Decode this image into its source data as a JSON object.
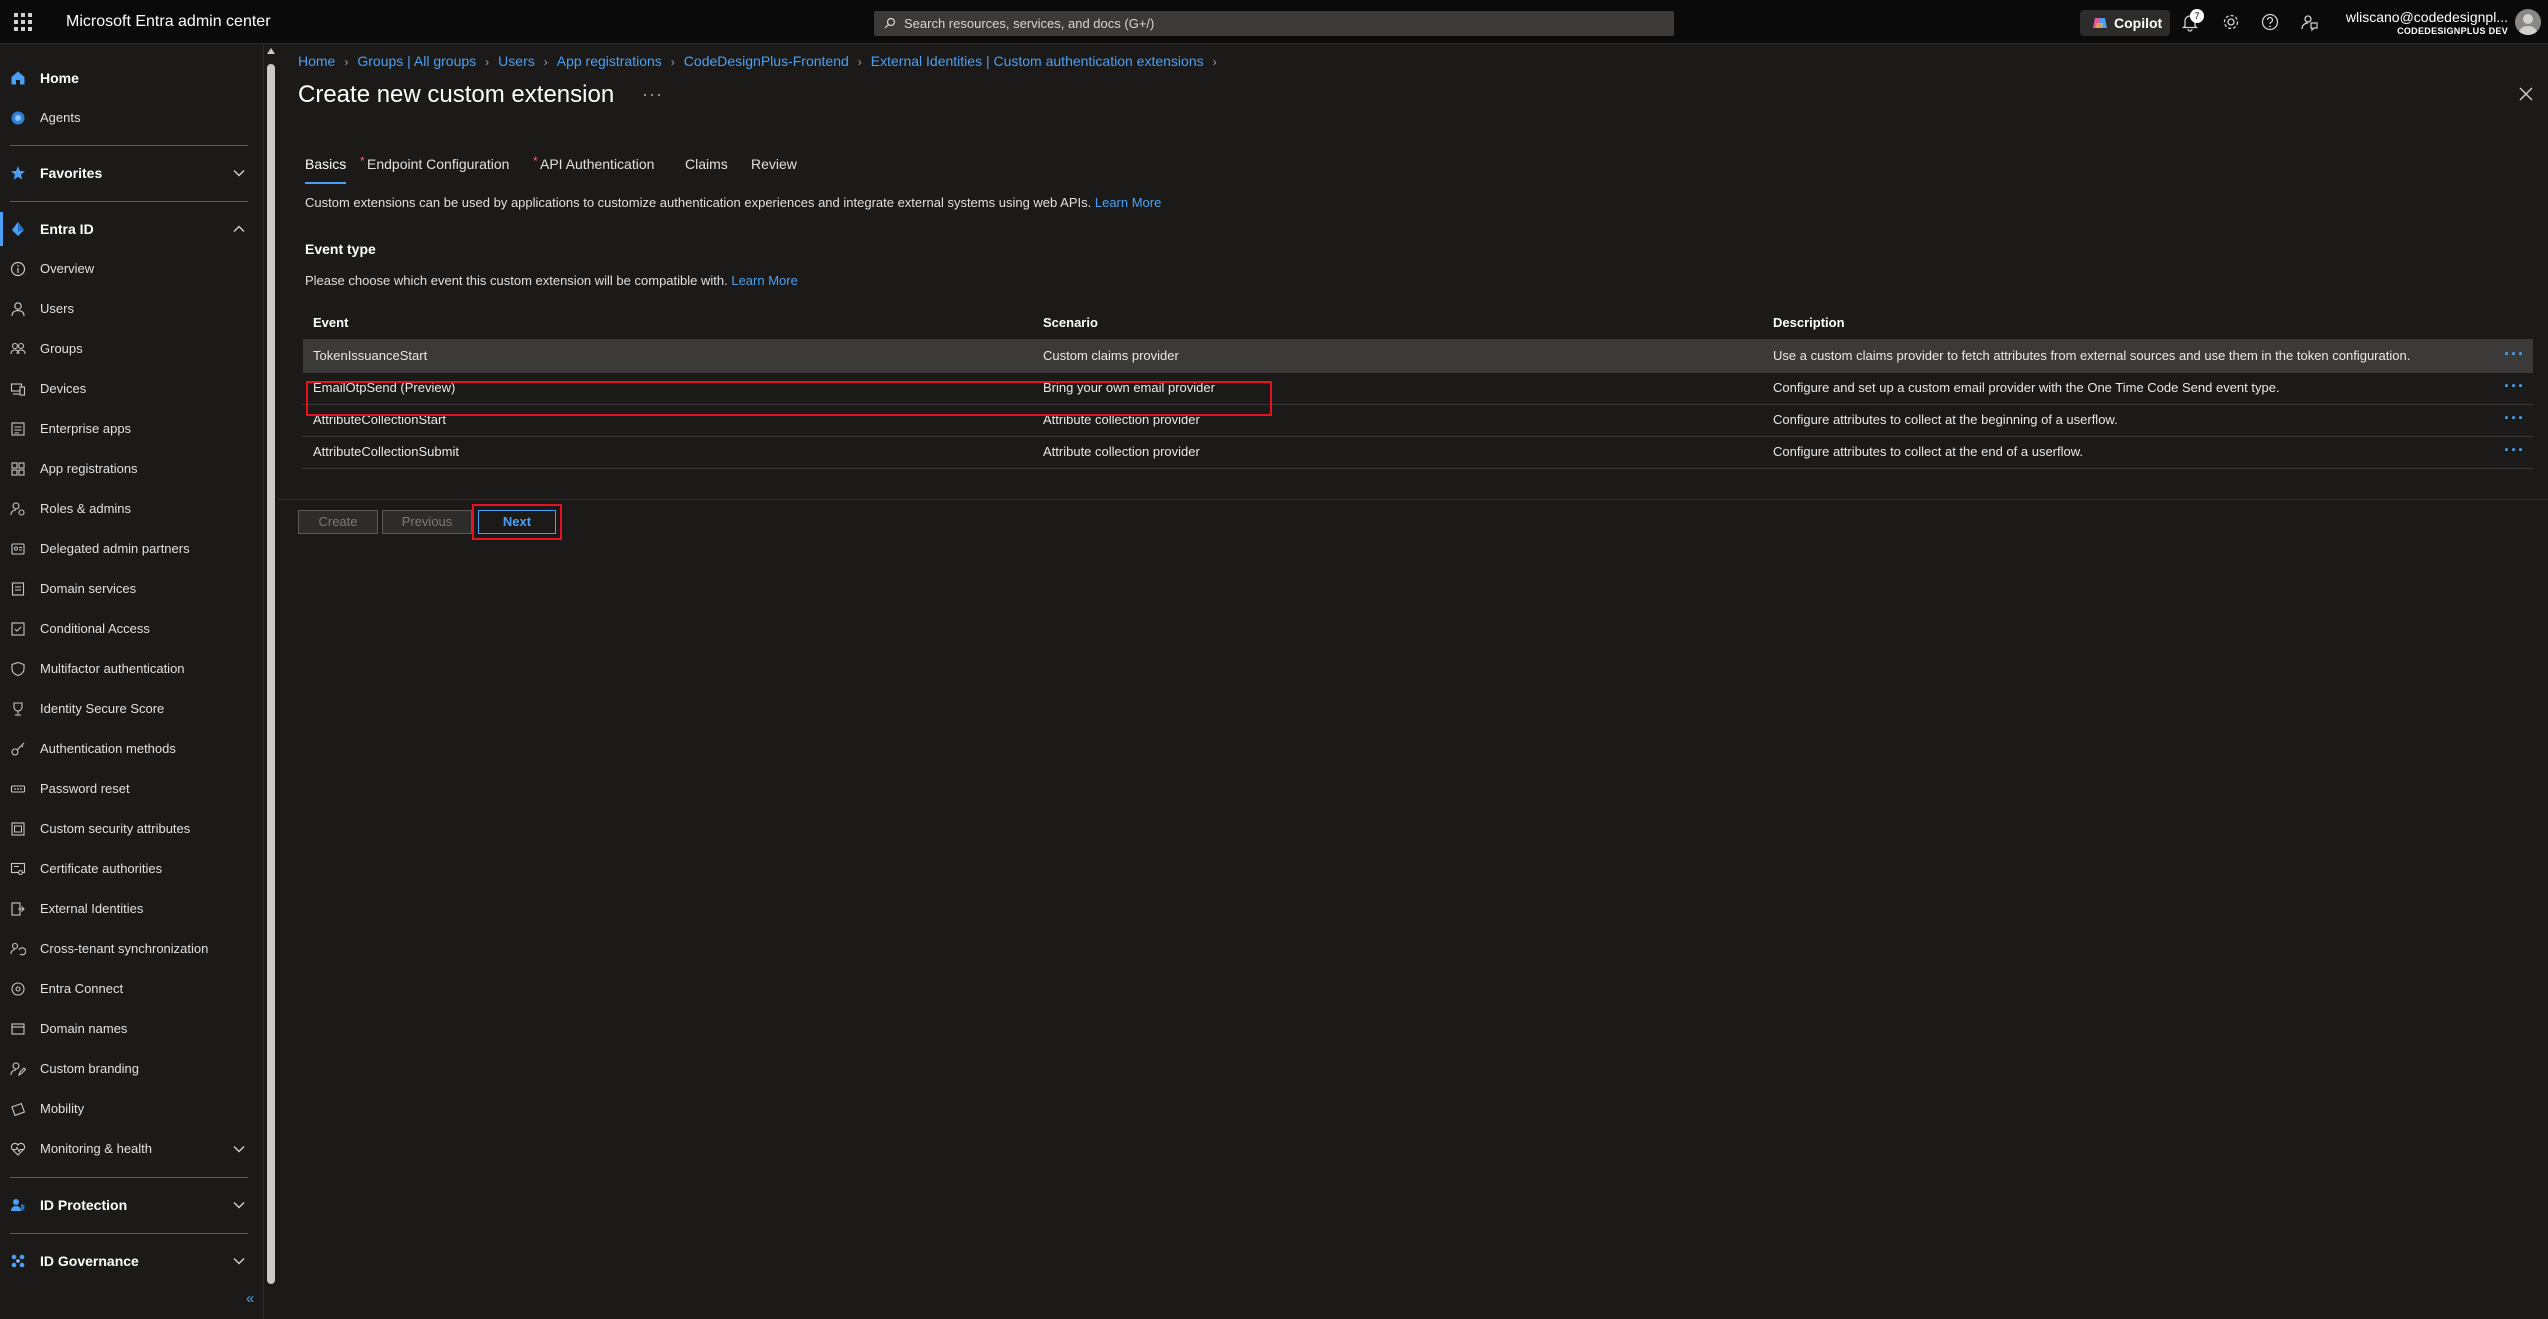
{
  "topbar": {
    "title": "Microsoft Entra admin center",
    "search_placeholder": "Search resources, services, and docs (G+/)",
    "copilot_label": "Copilot",
    "notification_count": "7",
    "user_name": "wliscano@codedesignpl...",
    "tenant_name": "CODEDESIGNPLUS DEV"
  },
  "sidebar": {
    "home": "Home",
    "agents": "Agents",
    "favorites": "Favorites",
    "entra_id": "Entra ID",
    "items": [
      "Overview",
      "Users",
      "Groups",
      "Devices",
      "Enterprise apps",
      "App registrations",
      "Roles & admins",
      "Delegated admin partners",
      "Domain services",
      "Conditional Access",
      "Multifactor authentication",
      "Identity Secure Score",
      "Authentication methods",
      "Password reset",
      "Custom security attributes",
      "Certificate authorities",
      "External Identities",
      "Cross-tenant synchronization",
      "Entra Connect",
      "Domain names",
      "Custom branding",
      "Mobility",
      "Monitoring & health"
    ],
    "id_protection": "ID Protection",
    "id_governance": "ID Governance",
    "collapse_glyph": "«"
  },
  "breadcrumb": [
    "Home",
    "Groups | All groups",
    "Users",
    "App registrations",
    "CodeDesignPlus-Frontend",
    "External Identities | Custom authentication extensions"
  ],
  "page": {
    "title": "Create new custom extension",
    "more_glyph": "···"
  },
  "tabs": [
    {
      "label": "Basics",
      "required": false,
      "active": true
    },
    {
      "label": "Endpoint Configuration",
      "required": true,
      "active": false
    },
    {
      "label": "API Authentication",
      "required": true,
      "active": false
    },
    {
      "label": "Claims",
      "required": false,
      "active": false
    },
    {
      "label": "Review",
      "required": false,
      "active": false
    }
  ],
  "intro": {
    "text": "Custom extensions can be used by applications to customize authentication experiences and integrate external systems using web APIs.",
    "link": "Learn More"
  },
  "event_type": {
    "heading": "Event type",
    "description": "Please choose which event this custom extension will be compatible with.",
    "link": "Learn More"
  },
  "table": {
    "headers": [
      "Event",
      "Scenario",
      "Description"
    ],
    "rows": [
      {
        "event": "TokenIssuanceStart",
        "scenario": "Custom claims provider",
        "description": "Use a custom claims provider to fetch attributes from external sources and use them in the token configuration.",
        "selected": true
      },
      {
        "event": "EmailOtpSend (Preview)",
        "scenario": "Bring your own email provider",
        "description": "Configure and set up a custom email provider with the One Time Code Send event type.",
        "selected": false
      },
      {
        "event": "AttributeCollectionStart",
        "scenario": "Attribute collection provider",
        "description": "Configure attributes to collect at the beginning of a userflow.",
        "selected": false
      },
      {
        "event": "AttributeCollectionSubmit",
        "scenario": "Attribute collection provider",
        "description": "Configure attributes to collect at the end of a userflow.",
        "selected": false
      }
    ],
    "row_more_glyph": "···"
  },
  "buttons": {
    "create": "Create",
    "previous": "Previous",
    "next": "Next"
  },
  "colors": {
    "accent": "#4ba0f5",
    "highlight": "#e81123",
    "required": "#e06c6c"
  }
}
